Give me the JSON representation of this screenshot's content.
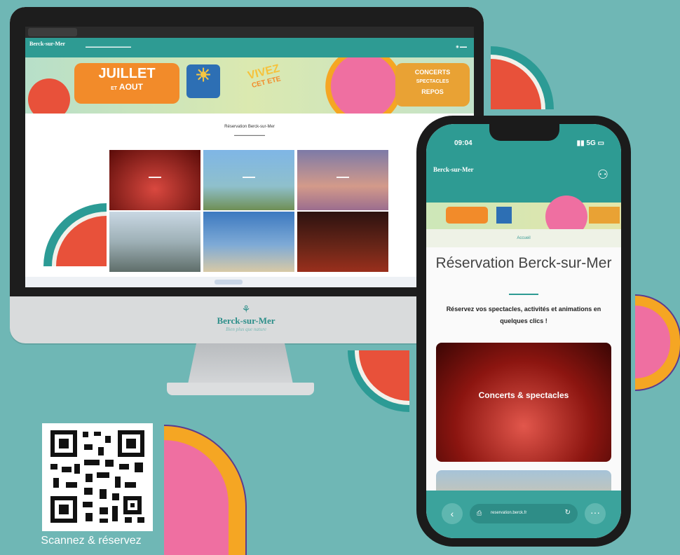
{
  "desktop": {
    "header_logo": "Berck-sur-Mer",
    "banner": {
      "juillet": "JUILLET",
      "et": "ET",
      "aout": "AOUT",
      "vivez": "VIVEZ",
      "cet_ete": "CET ETE",
      "concerts": "CONCERTS",
      "spectacles": "SPECTACLES",
      "repos": "REPOS"
    },
    "title": "Réservation Berck-sur-Mer"
  },
  "monitor_chin": {
    "logo": "Berck-sur-Mer",
    "tagline": "Bien plus que nature"
  },
  "phone": {
    "time": "09:04",
    "network": "5G",
    "logo": "Berck-sur-Mer",
    "crumb": "Accueil",
    "title": "Réservation Berck-sur-Mer",
    "subtitle": "Réservez vos spectacles, activités et animations en quelques clics !",
    "card_label": "Concerts & spectacles",
    "url": "reservation.berck.fr"
  },
  "qr": {
    "caption": "Scannez & réservez"
  },
  "colors": {
    "background": "#6fb7b5",
    "brand_teal": "#2e9b93",
    "orange": "#f5a623",
    "pink": "#ef6fa1",
    "watermelon": "#e8513a"
  },
  "icons": [
    "user-icon",
    "back-arrow-icon",
    "reload-icon",
    "more-icon",
    "lock-icon"
  ]
}
